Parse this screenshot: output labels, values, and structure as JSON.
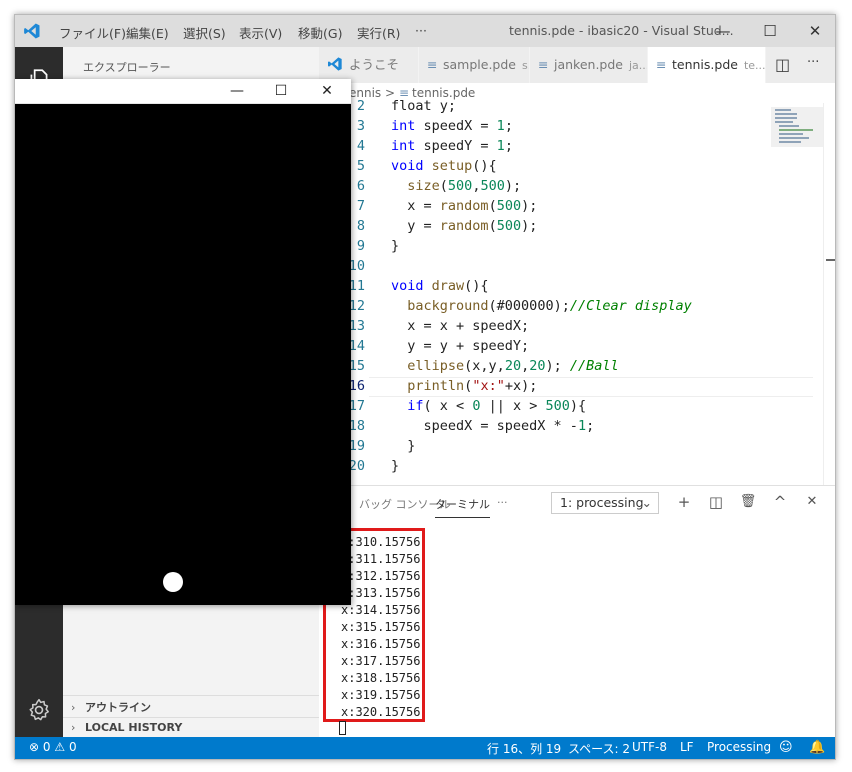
{
  "titlebar": {
    "menus": [
      "ファイル(F)",
      "編集(E)",
      "選択(S)",
      "表示(V)",
      "移動(G)",
      "実行(R)",
      "···"
    ],
    "window_title": "tennis.pde - ibasic20 - Visual Stud...",
    "minimize": "—",
    "maximize": "☐",
    "close": "✕"
  },
  "sidebar": {
    "title": "エクスプローラー",
    "sections": [
      "アウトライン",
      "LOCAL HISTORY"
    ]
  },
  "tabs": [
    {
      "label": "ようこそ",
      "desc": ""
    },
    {
      "label": "sample.pde",
      "desc": "s..."
    },
    {
      "label": "janken.pde",
      "desc": "ja..."
    },
    {
      "label": "tennis.pde",
      "desc": "te..."
    }
  ],
  "tab_actions": {
    "split": "◫",
    "more": "···"
  },
  "breadcrumb": {
    "folder": "ennis",
    "sep": ">",
    "file": "tennis.pde"
  },
  "editor": {
    "current_line": 16,
    "lines": [
      {
        "n": "2",
        "tokens": [
          {
            "t": "float y;",
            "c": "pl"
          }
        ]
      },
      {
        "n": "3",
        "tokens": [
          {
            "t": "int",
            "c": "ty"
          },
          {
            "t": " speedX = ",
            "c": "pl"
          },
          {
            "t": "1",
            "c": "num"
          },
          {
            "t": ";",
            "c": "pl"
          }
        ]
      },
      {
        "n": "4",
        "tokens": [
          {
            "t": "int",
            "c": "ty"
          },
          {
            "t": " speedY = ",
            "c": "pl"
          },
          {
            "t": "1",
            "c": "num"
          },
          {
            "t": ";",
            "c": "pl"
          }
        ]
      },
      {
        "n": "5",
        "tokens": [
          {
            "t": "void",
            "c": "ty"
          },
          {
            "t": " ",
            "c": "pl"
          },
          {
            "t": "setup",
            "c": "fn"
          },
          {
            "t": "(){",
            "c": "pl"
          }
        ]
      },
      {
        "n": "6",
        "tokens": [
          {
            "t": "  ",
            "c": "pl"
          },
          {
            "t": "size",
            "c": "fn"
          },
          {
            "t": "(",
            "c": "pl"
          },
          {
            "t": "500",
            "c": "num"
          },
          {
            "t": ",",
            "c": "pl"
          },
          {
            "t": "500",
            "c": "num"
          },
          {
            "t": ");",
            "c": "pl"
          }
        ]
      },
      {
        "n": "7",
        "tokens": [
          {
            "t": "  x = ",
            "c": "pl"
          },
          {
            "t": "random",
            "c": "fn"
          },
          {
            "t": "(",
            "c": "pl"
          },
          {
            "t": "500",
            "c": "num"
          },
          {
            "t": ");",
            "c": "pl"
          }
        ]
      },
      {
        "n": "8",
        "tokens": [
          {
            "t": "  y = ",
            "c": "pl"
          },
          {
            "t": "random",
            "c": "fn"
          },
          {
            "t": "(",
            "c": "pl"
          },
          {
            "t": "500",
            "c": "num"
          },
          {
            "t": ");",
            "c": "pl"
          }
        ]
      },
      {
        "n": "9",
        "tokens": [
          {
            "t": "}",
            "c": "pl"
          }
        ]
      },
      {
        "n": "10",
        "tokens": []
      },
      {
        "n": "11",
        "tokens": [
          {
            "t": "void",
            "c": "ty"
          },
          {
            "t": " ",
            "c": "pl"
          },
          {
            "t": "draw",
            "c": "fn"
          },
          {
            "t": "(){",
            "c": "pl"
          }
        ]
      },
      {
        "n": "12",
        "tokens": [
          {
            "t": "  ",
            "c": "pl"
          },
          {
            "t": "background",
            "c": "fn"
          },
          {
            "t": "(#000000);",
            "c": "pl"
          },
          {
            "t": "//Clear display",
            "c": "cm"
          }
        ]
      },
      {
        "n": "13",
        "tokens": [
          {
            "t": "  x = x + speedX;",
            "c": "pl"
          }
        ]
      },
      {
        "n": "14",
        "tokens": [
          {
            "t": "  y = y + speedY;",
            "c": "pl"
          }
        ]
      },
      {
        "n": "15",
        "tokens": [
          {
            "t": "  ",
            "c": "pl"
          },
          {
            "t": "ellipse",
            "c": "fn"
          },
          {
            "t": "(x,y,",
            "c": "pl"
          },
          {
            "t": "20",
            "c": "num"
          },
          {
            "t": ",",
            "c": "pl"
          },
          {
            "t": "20",
            "c": "num"
          },
          {
            "t": "); ",
            "c": "pl"
          },
          {
            "t": "//Ball",
            "c": "cm"
          }
        ]
      },
      {
        "n": "16",
        "tokens": [
          {
            "t": "  ",
            "c": "pl"
          },
          {
            "t": "println",
            "c": "fn"
          },
          {
            "t": "(",
            "c": "pl"
          },
          {
            "t": "\"x:\"",
            "c": "st"
          },
          {
            "t": "+x);",
            "c": "pl"
          }
        ]
      },
      {
        "n": "17",
        "tokens": [
          {
            "t": "  ",
            "c": "pl"
          },
          {
            "t": "if",
            "c": "kw"
          },
          {
            "t": "( x < ",
            "c": "pl"
          },
          {
            "t": "0",
            "c": "num"
          },
          {
            "t": " || x > ",
            "c": "pl"
          },
          {
            "t": "500",
            "c": "num"
          },
          {
            "t": "){",
            "c": "pl"
          }
        ]
      },
      {
        "n": "18",
        "tokens": [
          {
            "t": "    speedX = speedX * -",
            "c": "pl"
          },
          {
            "t": "1",
            "c": "num"
          },
          {
            "t": ";",
            "c": "pl"
          }
        ]
      },
      {
        "n": "19",
        "tokens": [
          {
            "t": "  }",
            "c": "pl"
          }
        ]
      },
      {
        "n": "20",
        "tokens": [
          {
            "t": "}",
            "c": "pl"
          }
        ]
      }
    ]
  },
  "panel": {
    "tabs": [
      "バッグ コンソール",
      "ターミナル",
      "···"
    ],
    "active_tab": "ターミナル",
    "terminal_select": "1: processing",
    "buttons": {
      "add": "+",
      "split": "◫",
      "trash": "🗑",
      "maximize": "^",
      "close": "✕"
    },
    "output": [
      "x:310.15756",
      "x:311.15756",
      "x:312.15756",
      "x:313.15756",
      "x:314.15756",
      "x:315.15756",
      "x:316.15756",
      "x:317.15756",
      "x:318.15756",
      "x:319.15756",
      "x:320.15756"
    ]
  },
  "statusbar": {
    "errors": "0",
    "warnings": "0",
    "position": "行 16、列 19",
    "spaces": "スペース: 2",
    "encoding": "UTF-8",
    "eol": "LF",
    "language": "Processing"
  },
  "sketch_window": {
    "minimize": "—",
    "maximize": "☐",
    "close": "✕"
  },
  "colors": {
    "accent": "#007acc",
    "highlight": "#e01a1a",
    "activity_bar": "#2c2c2c",
    "sketch_background": "#000000"
  }
}
